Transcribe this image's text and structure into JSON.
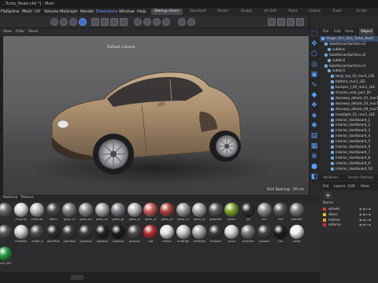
{
  "window": {
    "title": "...Turbo_Road.c4d *] - Main"
  },
  "menu": {
    "items": [
      "File",
      "Edit",
      "Create",
      "Modes",
      "Select",
      "Tools",
      "Spline",
      "Mesh",
      "UV",
      "Volume",
      "MoGraph",
      "Render",
      "Extensions",
      "Window",
      "Help"
    ],
    "active_item": "Extensions",
    "layouts": [
      "Startup (User)",
      "Standard",
      "Model",
      "Sculpt",
      "UV Edit",
      "Paint",
      "Groom",
      "Track",
      "Script"
    ],
    "selected_layout": "Startup (User)",
    "right_items": [
      "File",
      "Edit",
      "View",
      "Object"
    ]
  },
  "viewport": {
    "menu": [
      "View",
      "Cameras",
      "Display",
      "Options",
      "Filter",
      "Panel"
    ],
    "camera_label": "Default Camera",
    "grid_label": "Grid Spacing : 50 cm"
  },
  "object_manager": {
    "tabs": [
      "File",
      "Edit",
      "View",
      "Object"
    ],
    "active_tab": "Object",
    "rows": [
      {
        "label": "Singer_911_DLS_Turbo_Road",
        "indent": 0,
        "selected": true
      },
      {
        "label": "SubdivisionSurface.v3",
        "indent": 1,
        "selected": false
      },
      {
        "label": "subdivs",
        "indent": 2,
        "selected": false
      },
      {
        "label": "SubdivisionSurface.v2",
        "indent": 1,
        "selected": false
      },
      {
        "label": "subdiv2",
        "indent": 2,
        "selected": false
      },
      {
        "label": "SubdivisionSurface.v1",
        "indent": 1,
        "selected": false
      },
      {
        "label": "subdiv1",
        "indent": 2,
        "selected": false
      },
      {
        "label": "body_top_02_mur1_LEE",
        "indent": 3,
        "selected": false
      },
      {
        "label": "bottom_mur1_LEE",
        "indent": 3,
        "selected": false
      },
      {
        "label": "bumper_f_05_mur1_LEE",
        "indent": 3,
        "selected": false
      },
      {
        "label": "chrome_seat_part_00",
        "indent": 3,
        "selected": false
      },
      {
        "label": "doorway_details_01_mur1",
        "indent": 3,
        "selected": false
      },
      {
        "label": "doorway_details_03_mur1",
        "indent": 3,
        "selected": false
      },
      {
        "label": "doorway_details_04_mur1",
        "indent": 3,
        "selected": false
      },
      {
        "label": "headlight_01_mur1_LEE",
        "indent": 3,
        "selected": false
      },
      {
        "label": "interior_dashboard_1",
        "indent": 3,
        "selected": false
      },
      {
        "label": "interior_dashboard_2",
        "indent": 3,
        "selected": false
      },
      {
        "label": "interior_dashboard_3",
        "indent": 3,
        "selected": false
      },
      {
        "label": "interior_dashboard_4",
        "indent": 3,
        "selected": false
      },
      {
        "label": "interior_dashboard_5",
        "indent": 3,
        "selected": false
      },
      {
        "label": "interior_dashboard_6",
        "indent": 3,
        "selected": false
      },
      {
        "label": "interior_dashboard_7",
        "indent": 3,
        "selected": false
      },
      {
        "label": "interior_dashboard_8",
        "indent": 3,
        "selected": false
      },
      {
        "label": "interior_dashboard_9",
        "indent": 3,
        "selected": false
      },
      {
        "label": "interior_dashboard_10",
        "indent": 3,
        "selected": false
      }
    ],
    "bottom_tabs": [
      "Attributes",
      "Render Settings"
    ]
  },
  "layers": {
    "menu": [
      "File",
      "Layers",
      "Edit",
      "View"
    ],
    "add_label": "+",
    "name_header": "Name",
    "rows": [
      {
        "name": "wheels",
        "color": "#d43a2a"
      },
      {
        "name": "doors",
        "color": "#e0c21e"
      },
      {
        "name": "interior",
        "color": "#e8a020"
      },
      {
        "name": "exterior",
        "color": "#c83030"
      }
    ]
  },
  "material_manager": {
    "menu": [
      "Create",
      "Edit",
      "View",
      "Select",
      "Material",
      "Texture"
    ],
    "materials": [
      {
        "name": "",
        "color": "#6a6a6a"
      },
      {
        "name": "chromel",
        "color": "#d8d8d8"
      },
      {
        "name": "chromeL",
        "color": "#bdbdbd"
      },
      {
        "name": "fabric",
        "color": "#4a4a4a"
      },
      {
        "name": "glass_tu",
        "color": "#7f7f82"
      },
      {
        "name": "glass_bu",
        "color": "#8c8c90"
      },
      {
        "name": "glass_dc",
        "color": "#a7a7aa"
      },
      {
        "name": "glass_gr",
        "color": "#808084"
      },
      {
        "name": "glass_rs",
        "color": "#b7b7ba"
      },
      {
        "name": "glass_re",
        "color": "#c95a5a"
      },
      {
        "name": "glass_re",
        "color": "#b04444"
      },
      {
        "name": "glass_re",
        "color": "#9a9a9d"
      },
      {
        "name": "glass_re",
        "color": "#a8a8ab"
      },
      {
        "name": "graphite",
        "color": "#5a5a5c"
      },
      {
        "name": "green",
        "color": "#7fa32a"
      },
      {
        "name": "Int",
        "color": "#2e2e30"
      },
      {
        "name": "int3",
        "color": "#8a8a8c"
      },
      {
        "name": "int2",
        "color": "#5a5a5a"
      },
      {
        "name": "leatheR",
        "color": "#7a7a7a"
      },
      {
        "name": "",
        "color": "#555555"
      },
      {
        "name": "metalBo",
        "color": "#cfcfcf"
      },
      {
        "name": "metal_d",
        "color": "#4d4d4f"
      },
      {
        "name": "paintBas",
        "color": "#2d2d2f"
      },
      {
        "name": "paintBas",
        "color": "#3a3a3c"
      },
      {
        "name": "plasticbl",
        "color": "#3c3c3e"
      },
      {
        "name": "plasticb",
        "color": "#232325"
      },
      {
        "name": "plasticp",
        "color": "#1c1c1e"
      },
      {
        "name": "plasticz",
        "color": "#4b4b4d"
      },
      {
        "name": "red",
        "color": "#b63030"
      },
      {
        "name": "reflect",
        "color": "#e4e4e4"
      },
      {
        "name": "rimBrigh",
        "color": "#c8c8c8"
      },
      {
        "name": "rimBrigh",
        "color": "#a9a9ab"
      },
      {
        "name": "rimDark",
        "color": "#3a3a3c"
      },
      {
        "name": "silver",
        "color": "#d4d4d6"
      },
      {
        "name": "silverDa",
        "color": "#7c7c7e"
      },
      {
        "name": "speaker",
        "color": "#444446"
      },
      {
        "name": "tire",
        "color": "#1e1e20"
      },
      {
        "name": "white",
        "color": "#f0f0f0"
      },
      {
        "name": "wine_001",
        "color": "#2a9a40"
      }
    ]
  },
  "palette_icons": [
    "cursor-icon",
    "move-icon",
    "scale-icon",
    "rotate-icon",
    "cube-icon",
    "spline-icon",
    "nurbs-icon",
    "array-icon",
    "deformer-icon",
    "light-icon",
    "camera-icon",
    "grid-icon",
    "xpresso-icon",
    "sphere-icon",
    "tag-icon"
  ],
  "colors": {
    "accent": "#3f6fc9",
    "car_body": "#a88c6c",
    "selection": "#3a4b6a"
  }
}
